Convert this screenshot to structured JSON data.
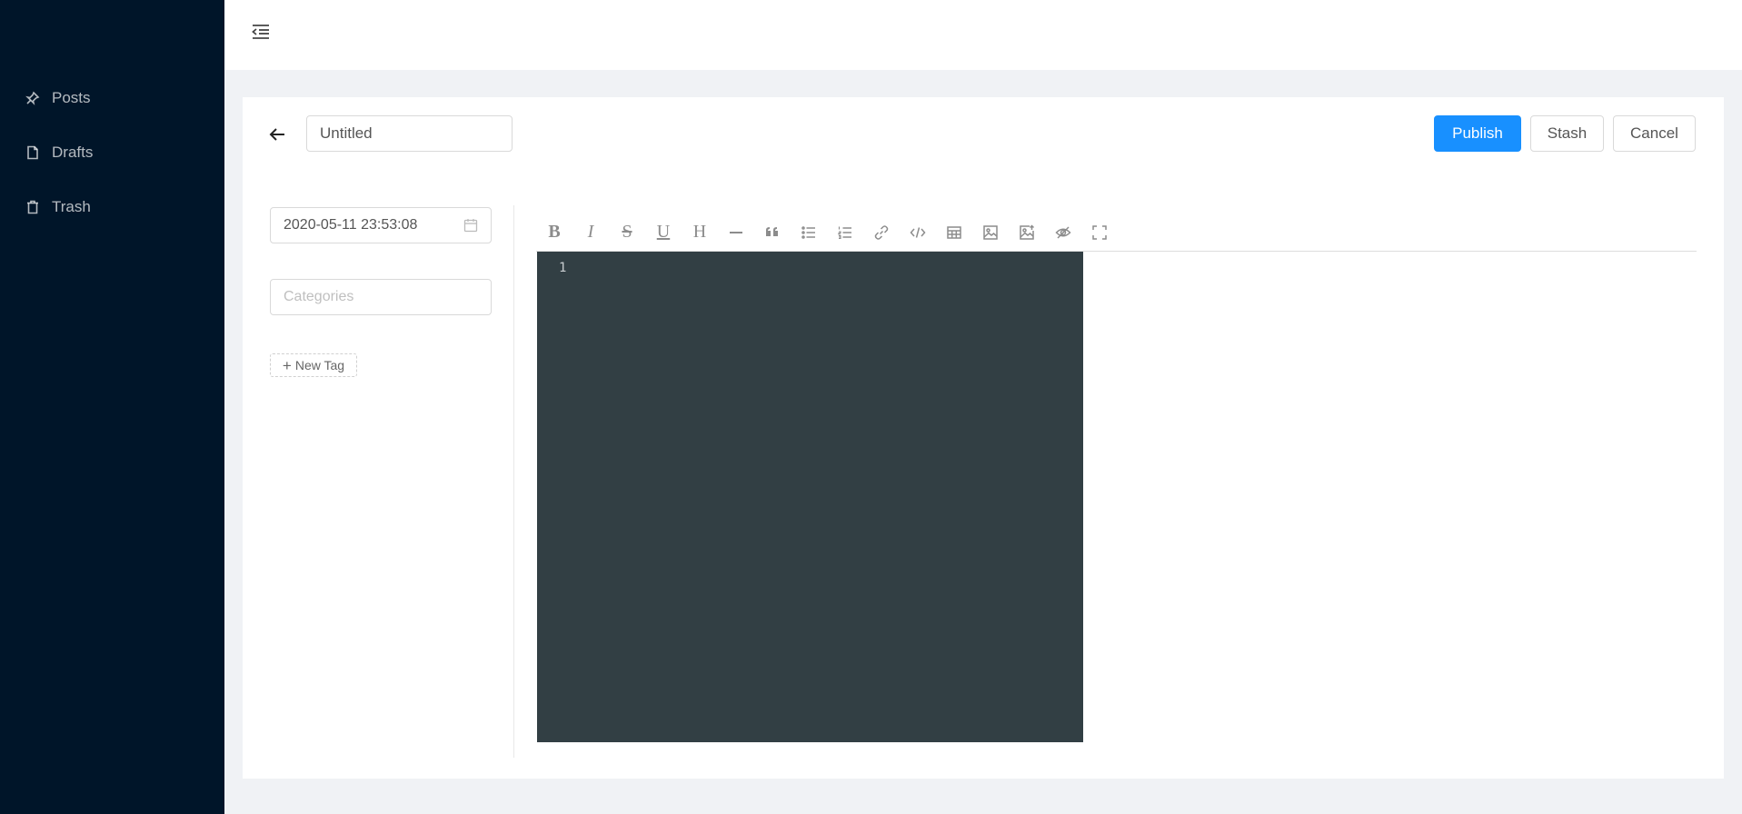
{
  "sidebar": {
    "items": [
      {
        "label": "Posts",
        "icon": "pin-icon"
      },
      {
        "label": "Drafts",
        "icon": "file-icon"
      },
      {
        "label": "Trash",
        "icon": "trash-icon"
      }
    ]
  },
  "header": {
    "collapse_icon": "menu-fold-icon"
  },
  "editor_header": {
    "title_value": "Untitled",
    "publish_label": "Publish",
    "stash_label": "Stash",
    "cancel_label": "Cancel"
  },
  "meta": {
    "date_value": "2020-05-11 23:53:08",
    "categories_placeholder": "Categories",
    "new_tag_label": "New Tag"
  },
  "toolbar": {
    "buttons": [
      "bold",
      "italic",
      "strikethrough",
      "underline",
      "heading",
      "horizontal-rule",
      "quote",
      "unordered-list",
      "ordered-list",
      "link",
      "code",
      "table",
      "image",
      "image-upload",
      "preview",
      "fullscreen"
    ]
  },
  "editor": {
    "line_number": "1"
  },
  "colors": {
    "sidebar_bg": "#001529",
    "primary": "#1890ff",
    "editor_bg": "#323f44",
    "page_bg": "#f0f2f5"
  }
}
